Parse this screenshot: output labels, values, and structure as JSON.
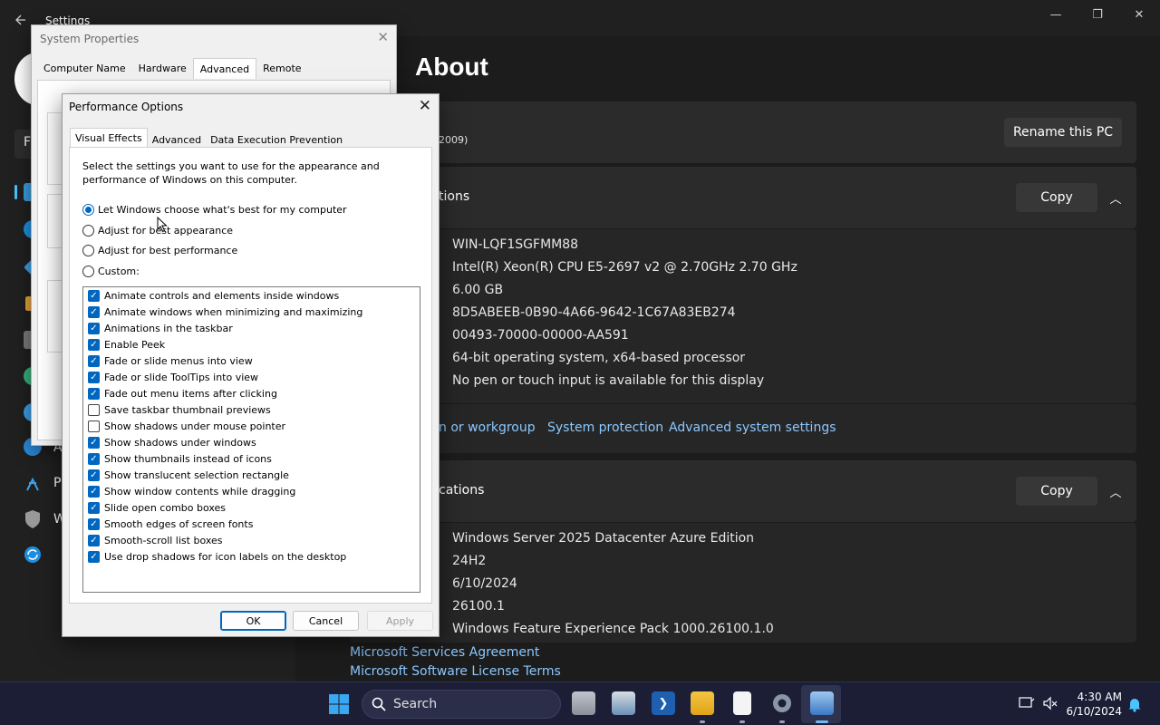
{
  "settings": {
    "window_title": "Settings",
    "page_title": "About",
    "rename_button": "Rename this PC",
    "device_name_partial": "2009)",
    "device_specs": {
      "header_partial": "tions",
      "copy_label": "Copy",
      "values": [
        "WIN-LQF1SGFMM88",
        "Intel(R) Xeon(R) CPU E5-2697 v2 @ 2.70GHz   2.70 GHz",
        "6.00 GB",
        "8D5ABEEB-0B90-4A66-9642-1C67A83EB274",
        "00493-70000-00000-AA591",
        "64-bit operating system, x64-based processor",
        "No pen or touch input is available for this display"
      ]
    },
    "related_links": {
      "domain_partial": "n or workgroup",
      "system_protection": "System protection",
      "advanced_settings": "Advanced system settings"
    },
    "windows_specs": {
      "header_partial": "cations",
      "copy_label": "Copy",
      "values": [
        "Windows Server 2025 Datacenter Azure Edition",
        "24H2",
        "6/10/2024",
        "26100.1",
        "Windows Feature Experience Pack 1000.26100.1.0"
      ]
    },
    "footer_links": [
      "Microsoft Services Agreement",
      "Microsoft Software License Terms"
    ],
    "left_partials": [
      "F",
      "A",
      "P",
      "W"
    ]
  },
  "system_properties": {
    "title": "System Properties",
    "tabs": [
      "Computer Name",
      "Hardware",
      "Advanced",
      "Remote"
    ],
    "active_tab": "Advanced"
  },
  "performance_options": {
    "title": "Performance Options",
    "tabs": [
      "Visual Effects",
      "Advanced",
      "Data Execution Prevention"
    ],
    "active_tab": "Visual Effects",
    "description": "Select the settings you want to use for the appearance and performance of Windows on this computer.",
    "radio_options": [
      {
        "label": "Let Windows choose what's best for my computer",
        "selected": true
      },
      {
        "label": "Adjust for best appearance",
        "selected": false
      },
      {
        "label": "Adjust for best performance",
        "selected": false
      },
      {
        "label": "Custom:",
        "selected": false
      }
    ],
    "effects": [
      {
        "label": "Animate controls and elements inside windows",
        "checked": true
      },
      {
        "label": "Animate windows when minimizing and maximizing",
        "checked": true
      },
      {
        "label": "Animations in the taskbar",
        "checked": true
      },
      {
        "label": "Enable Peek",
        "checked": true
      },
      {
        "label": "Fade or slide menus into view",
        "checked": true
      },
      {
        "label": "Fade or slide ToolTips into view",
        "checked": true
      },
      {
        "label": "Fade out menu items after clicking",
        "checked": true
      },
      {
        "label": "Save taskbar thumbnail previews",
        "checked": false
      },
      {
        "label": "Show shadows under mouse pointer",
        "checked": false
      },
      {
        "label": "Show shadows under windows",
        "checked": true
      },
      {
        "label": "Show thumbnails instead of icons",
        "checked": true
      },
      {
        "label": "Show translucent selection rectangle",
        "checked": true
      },
      {
        "label": "Show window contents while dragging",
        "checked": true
      },
      {
        "label": "Slide open combo boxes",
        "checked": true
      },
      {
        "label": "Smooth edges of screen fonts",
        "checked": true
      },
      {
        "label": "Smooth-scroll list boxes",
        "checked": true
      },
      {
        "label": "Use drop shadows for icon labels on the desktop",
        "checked": true
      }
    ],
    "buttons": {
      "ok": "OK",
      "cancel": "Cancel",
      "apply": "Apply"
    }
  },
  "taskbar": {
    "search_label": "Search",
    "time": "4:30 AM",
    "date": "6/10/2024",
    "pinned_icons": [
      "task-view-icon",
      "server-manager-icon",
      "powershell-icon",
      "file-explorer-icon",
      "notepad-icon",
      "settings-icon",
      "system-properties-icon"
    ]
  },
  "colors": {
    "accent": "#0067c0",
    "link": "#8cc8ff",
    "taskbar_bg": "#1b1e35",
    "settings_bg": "#202020",
    "card_bg": "#2b2b2b"
  }
}
